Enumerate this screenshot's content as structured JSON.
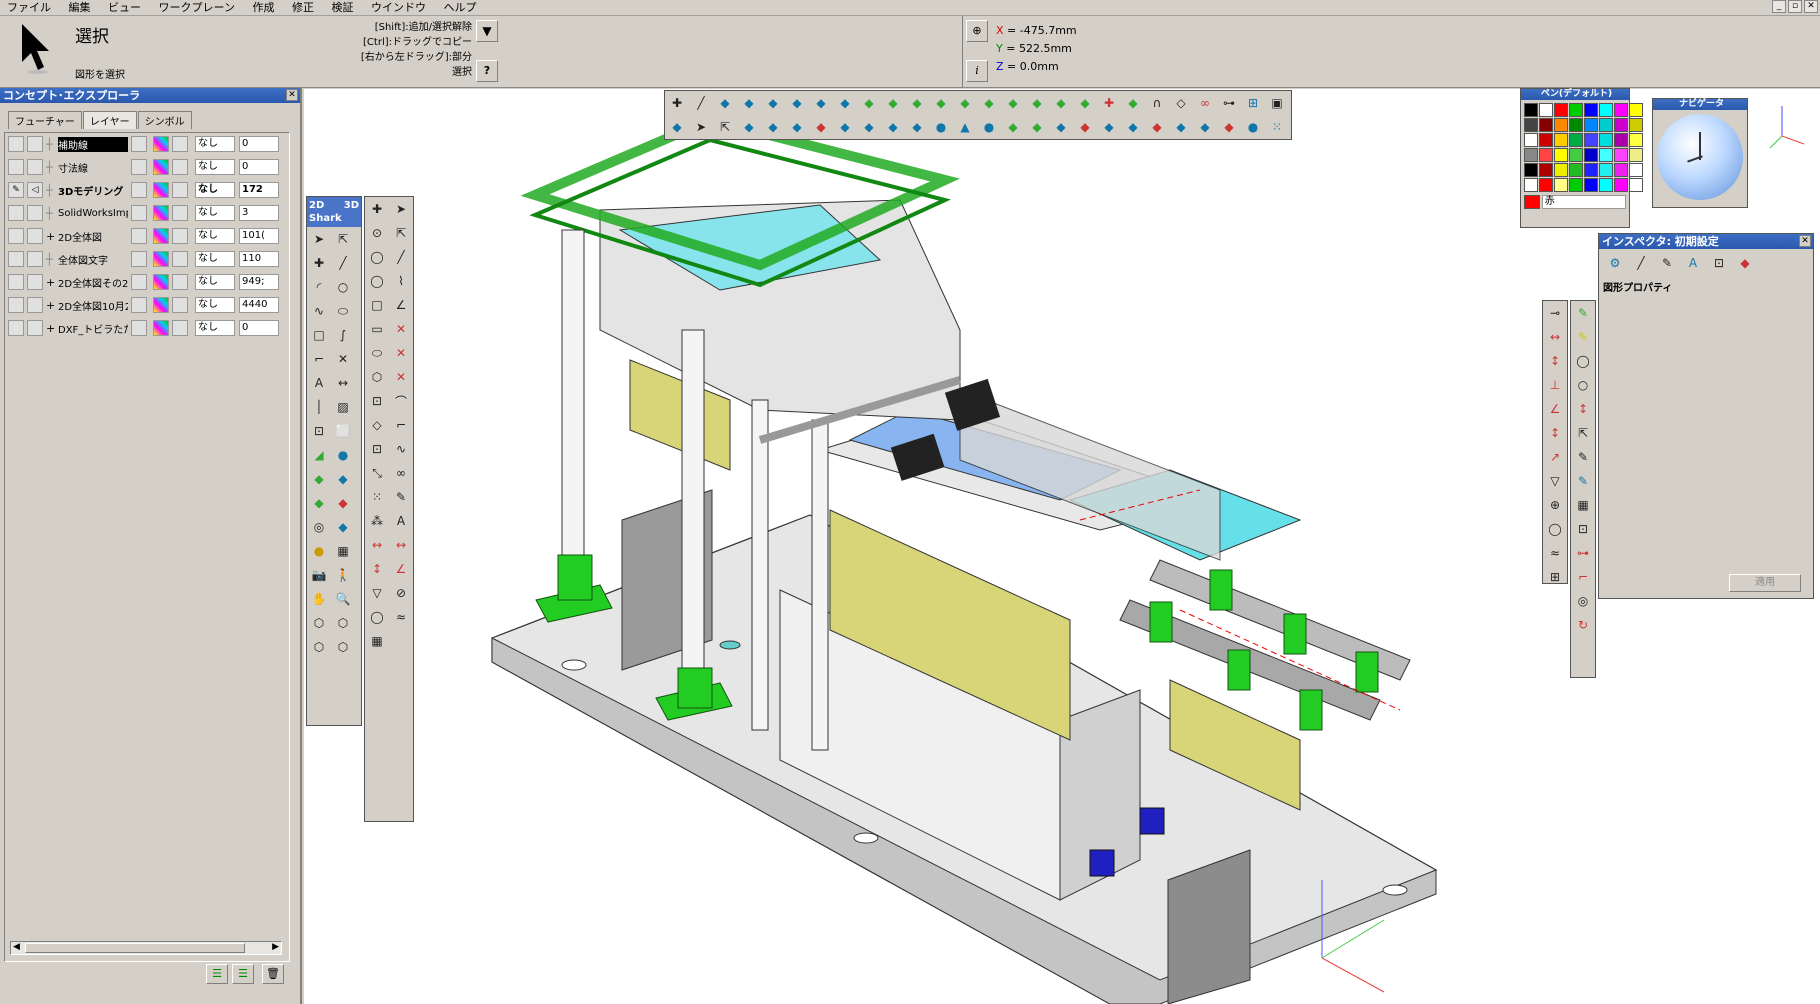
{
  "menu": [
    "ファイル",
    "編集",
    "ビュー",
    "ワークプレーン",
    "作成",
    "修正",
    "検証",
    "ウインドウ",
    "ヘルプ"
  ],
  "window_controls": [
    "_",
    "▫",
    "✕"
  ],
  "tool": {
    "name": "選択",
    "hint": "図形を選択"
  },
  "shortcuts": [
    "[Shift]:追加/選択解除",
    "[Ctrl]:ドラッグでコピー",
    "[右から左ドラッグ]:部分選択"
  ],
  "coords": {
    "x_label": "X",
    "x": "= -475.7mm",
    "y_label": "Y",
    "y": "= 522.5mm",
    "z_label": "Z",
    "z": "= 0.0mm"
  },
  "explorer": {
    "title": "コンセプト･エクスプローラ",
    "tabs": [
      "フューチャー",
      "レイヤー",
      "シンボル"
    ],
    "layers": [
      {
        "name": "補助線",
        "line": "なし",
        "count": "0",
        "selected": true
      },
      {
        "name": "寸法線",
        "line": "なし",
        "count": "0"
      },
      {
        "name": "3Dモデリング",
        "line": "なし",
        "count": "172",
        "bold": true
      },
      {
        "name": "SolidWorksImp",
        "line": "なし",
        "count": "3"
      },
      {
        "name": "2D全体図",
        "line": "なし",
        "count": "101("
      },
      {
        "name": "全体図文字",
        "line": "なし",
        "count": "110"
      },
      {
        "name": "2D全体図その2",
        "line": "なし",
        "count": "949;"
      },
      {
        "name": "2D全体図10月2",
        "line": "なし",
        "count": "4440"
      },
      {
        "name": "DXF_トビラたたき",
        "line": "なし",
        "count": "0"
      }
    ]
  },
  "palette": {
    "title": "ペン(デフォルト)",
    "current": "赤"
  },
  "navigator": {
    "title": "ナビゲータ"
  },
  "inspector": {
    "title": "インスペクタ: 初期設定",
    "section": "図形プロパティ",
    "apply": "適用"
  },
  "toolbox": {
    "label_2d": "2D",
    "label_3d": "3D",
    "label_brand": "Shark"
  },
  "colors": {
    "titlebar": "#2a58ad",
    "model_green": "#22cc22",
    "model_yellow": "#d8d478",
    "model_blue": "#88b4f0"
  }
}
